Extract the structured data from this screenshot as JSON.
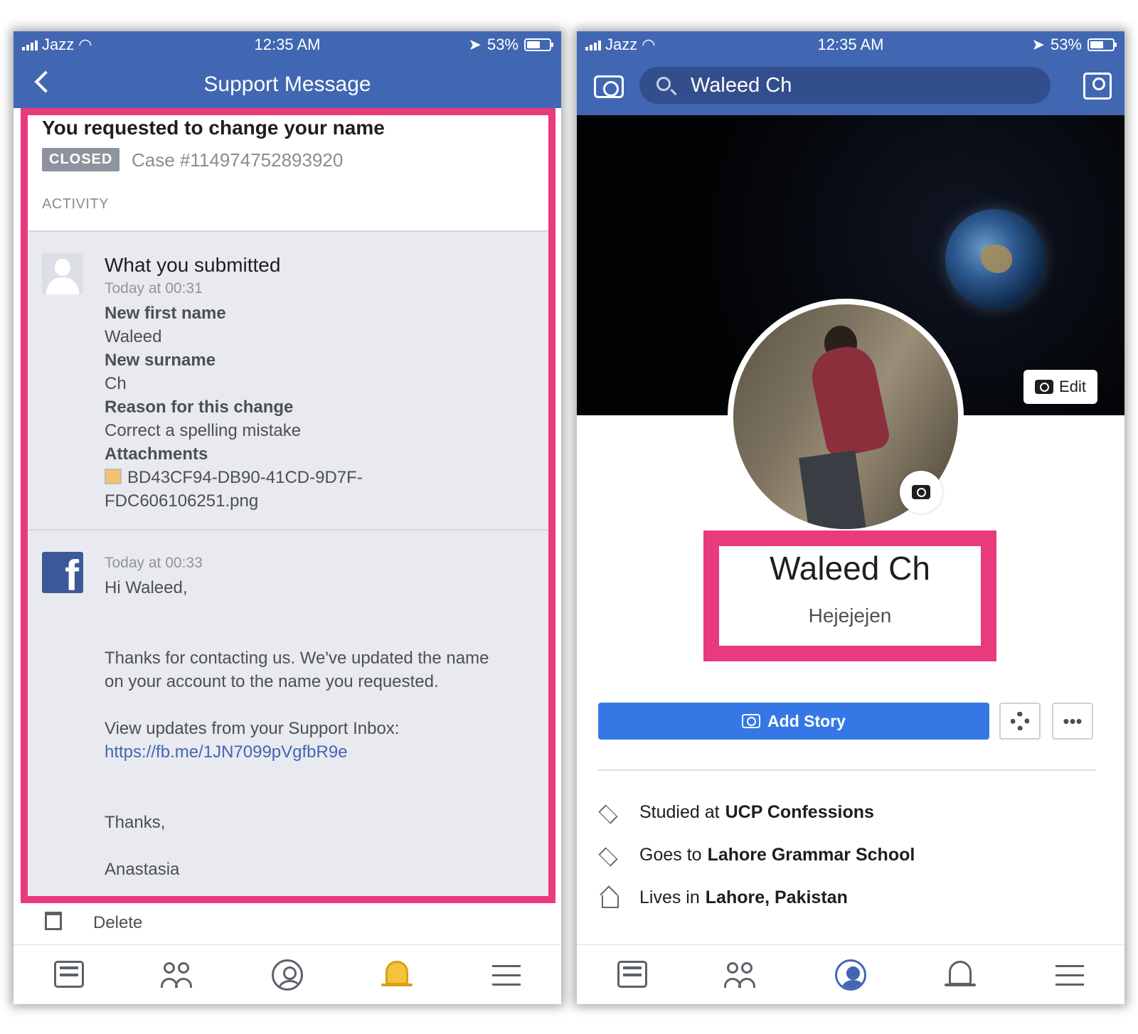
{
  "status": {
    "carrier": "Jazz",
    "time": "12:35 AM",
    "battery": "53%"
  },
  "left": {
    "nav_title": "Support Message",
    "request_title": "You requested to change your name",
    "badge": "CLOSED",
    "case": "Case #114974752893920",
    "section_label": "ACTIVITY",
    "submitted": {
      "title": "What you submitted",
      "time": "Today at 00:31",
      "first_name_label": "New first name",
      "first_name": "Waleed",
      "surname_label": "New surname",
      "surname": "Ch",
      "reason_label": "Reason for this change",
      "reason": "Correct a spelling mistake",
      "attachments_label": "Attachments",
      "attachment_line1": "BD43CF94-DB90-41CD-9D7F-",
      "attachment_line2": "FDC606106251.png"
    },
    "reply": {
      "time": "Today at 00:33",
      "greeting": "Hi Waleed,",
      "body_line1": "Thanks for contacting us. We've updated the name",
      "body_line2": "on your account to the name you requested.",
      "inbox_text": "View updates from your Support Inbox:",
      "link": "https://fb.me/1JN7099pVgfbR9e",
      "thanks": "Thanks,",
      "signature": "Anastasia"
    },
    "delete_label": "Delete"
  },
  "right": {
    "search_value": "Waleed Ch",
    "edit_cover_label": "Edit",
    "profile_name": "Waleed Ch",
    "bio": "Hejejejen",
    "add_story_label": "Add Story",
    "more_label": "•••",
    "info": [
      {
        "prefix": "Studied at",
        "value": "UCP Confessions",
        "icon": "graduation-cap-icon"
      },
      {
        "prefix": "Goes to",
        "value": "Lahore Grammar School",
        "icon": "graduation-cap-icon"
      },
      {
        "prefix": "Lives in",
        "value": "Lahore, Pakistan",
        "icon": "home-icon"
      }
    ]
  },
  "colors": {
    "facebook_blue": "#4167b2",
    "highlight_pink": "#e93a7d",
    "add_story_blue": "#3578e5",
    "closed_badge": "#8d949e"
  },
  "tabs": {
    "left_active": "notifications-tab",
    "right_active": "profile-tab"
  }
}
